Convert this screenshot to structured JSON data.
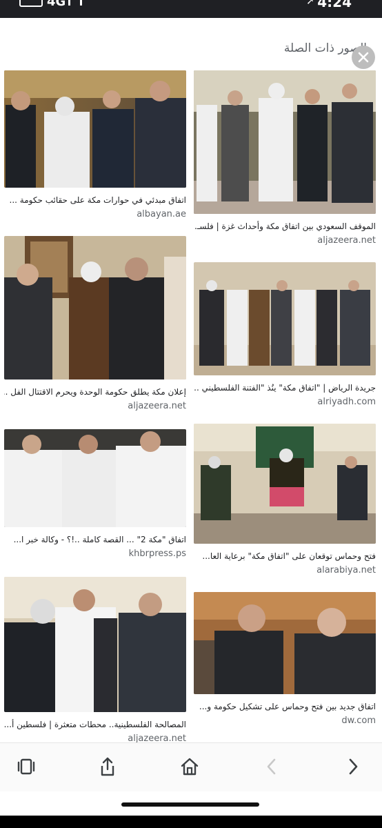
{
  "status": {
    "carrier": "4G",
    "time": "4:24"
  },
  "header": {
    "title": "الصور ذات الصلة"
  },
  "results": [
    {
      "caption": "اتفاق مبدئي في حوارات مكة على حقائب حكومة ...",
      "source": "albayan.ae"
    },
    {
      "caption": "الموقف السعودي بين اتفاق مكة وأحداث غزة | فلسـ...",
      "source": "aljazeera.net"
    },
    {
      "caption": "إعلان مكة يطلق حكومة الوحدة ويحرم الاقتتال الفل ...",
      "source": "aljazeera.net"
    },
    {
      "caption": "جريدة الرياض | \"اتفاق مكة\" ينُذ \"الفتنة الفلسطيني ..",
      "source": "alriyadh.com"
    },
    {
      "caption": "اتفاق \"مكة 2\" ... القصة كاملة ..!؟ - وكالة خبر ا...",
      "source": "khbrpress.ps"
    },
    {
      "caption": "فتح وحماس توقعان على \"اتفاق مكة\" برعاية العا...",
      "source": "alarabiya.net"
    },
    {
      "caption": "المصالحة الفلسطينية.. محطات متعثرة | فلسطين أ...",
      "source": "aljazeera.net"
    },
    {
      "caption": "اتفاق جديد بين فتح وحماس على تشكيل حكومة و...",
      "source": "dw.com"
    }
  ],
  "icons": {
    "close": "close-icon",
    "tabs": "tabs-icon",
    "share": "share-icon",
    "home": "home-icon",
    "back": "back-arrow-icon",
    "forward": "forward-arrow-icon"
  }
}
